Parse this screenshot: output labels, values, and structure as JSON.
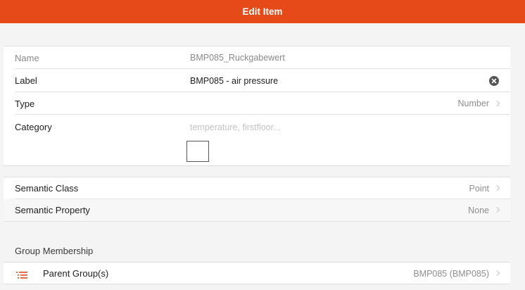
{
  "navbar": {
    "title": "Edit Item"
  },
  "item": {
    "name_label": "Name",
    "name_value": "BMP085_Ruckgabewert",
    "label_label": "Label",
    "label_value": "BMP085 - air pressure",
    "type_label": "Type",
    "type_value": "Number",
    "category_label": "Category",
    "category_placeholder": "temperature, firstfloor..."
  },
  "semantics": {
    "class_label": "Semantic Class",
    "class_value": "Point",
    "property_label": "Semantic Property",
    "property_value": "None"
  },
  "groups": {
    "section_title": "Group Membership",
    "parent_label": "Parent Group(s)",
    "parent_value": "BMP085 (BMP085)"
  },
  "colors": {
    "accent": "#e64a19",
    "list_icon": "#e64a19"
  },
  "icons": {
    "clear": "close-circle-icon",
    "chevron": "chevron-right-icon",
    "list": "list-icon"
  }
}
